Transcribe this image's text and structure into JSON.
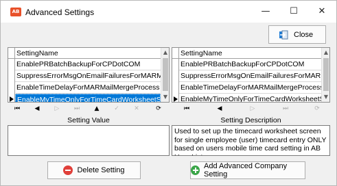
{
  "window": {
    "app_icon_text": "AB",
    "title": "Advanced Settings",
    "minimize_glyph": "—",
    "maximize_glyph": "☐",
    "close_glyph": "✕"
  },
  "toolbar": {
    "close_label": "Close",
    "close_icon": "exit-door-icon"
  },
  "settings_grid": {
    "column_header": "SettingName",
    "rows": [
      "EnablePRBatchBackupForCPDotCOM",
      "SuppressErrorMsgOnEmailFailuresForMARMailMer",
      "EnableTimeDelayForMARMailMergeProcess",
      "EnableMyTimeOnlyForTimeCardWorksheetScreen"
    ],
    "selected_index": 3
  },
  "description_grid": {
    "column_header": "SettingName",
    "rows": [
      "EnablePRBatchBackupForCPDotCOM",
      "SuppressErrorMsgOnEmailFailuresForMARMailMe",
      "EnableTimeDelayForMARMailMergeProcess",
      "EnableMyTimeOnlyForTimeCardWorksheetScreen"
    ],
    "current_index": 3
  },
  "navigator_left": {
    "first": "⏮",
    "prev": "◀",
    "next": "▷",
    "last": "⏭",
    "add": "▲",
    "edit": "✓",
    "delete": "✕",
    "refresh": "⟳"
  },
  "navigator_right": {
    "first": "⏮",
    "prev": "◀",
    "next": "▷",
    "last": "⏭",
    "refresh": "⟳"
  },
  "setting_value": {
    "label": "Setting Value",
    "value": ""
  },
  "setting_description": {
    "label": "Setting Description",
    "text": "Used to set up the timecard worksheet screen for single employee (user) timecard entry ONLY based on users mobile time card setting in AB User List."
  },
  "buttons": {
    "delete_label": "Delete Setting",
    "add_label": "Add Advanced Company Setting"
  },
  "colors": {
    "selection": "#0078d7",
    "delete_icon": "#e0403a",
    "add_icon": "#3aa548",
    "app_icon": "#e8512a"
  }
}
